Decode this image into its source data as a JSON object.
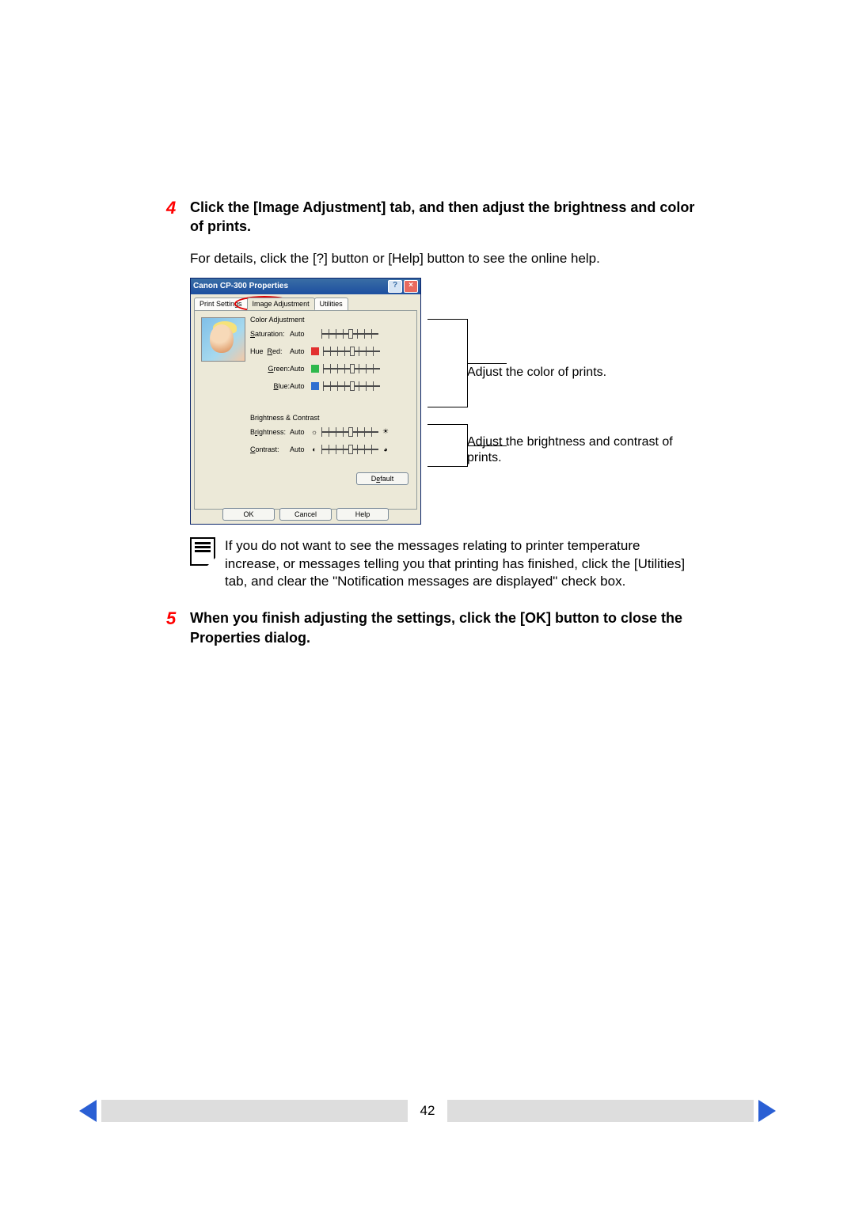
{
  "steps": {
    "s4": {
      "num": "4",
      "title": "Click the [Image Adjustment] tab, and then adjust the brightness and color of prints.",
      "sub": "For details, click the [?] button or [Help] button to see the online help."
    },
    "s5": {
      "num": "5",
      "title": "When you finish adjusting the settings, click the [OK] button to close the Properties dialog."
    }
  },
  "dialog": {
    "title": "Canon CP-300 Properties",
    "help_btn": "?",
    "close_btn": "×",
    "tabs": {
      "print": "Print Settings",
      "image": "Image Adjustment",
      "util": "Utilities"
    },
    "groups": {
      "color": "Color Adjustment",
      "bc": "Brightness & Contrast"
    },
    "labels": {
      "saturation": "Saturation:",
      "hue_red": "Hue   Red:",
      "green": "Green:",
      "blue": "Blue:",
      "brightness": "Brightness:",
      "contrast": "Contrast:"
    },
    "value_auto": "Auto",
    "buttons": {
      "default": "Default",
      "ok": "OK",
      "cancel": "Cancel",
      "help": "Help"
    },
    "icons": {
      "sun_dim": "☼",
      "sun_bright": "☀",
      "moon": "◐",
      "full": "◕"
    }
  },
  "callouts": {
    "color": "Adjust the color of prints.",
    "brightness": "Adjust the brightness and contrast of prints."
  },
  "note": "If you do not want to see the messages relating to printer temperature increase, or messages telling you that printing has finished, click the [Utilities] tab, and clear the \"Notification messages are displayed\" check box.",
  "footer": {
    "page": "42"
  }
}
